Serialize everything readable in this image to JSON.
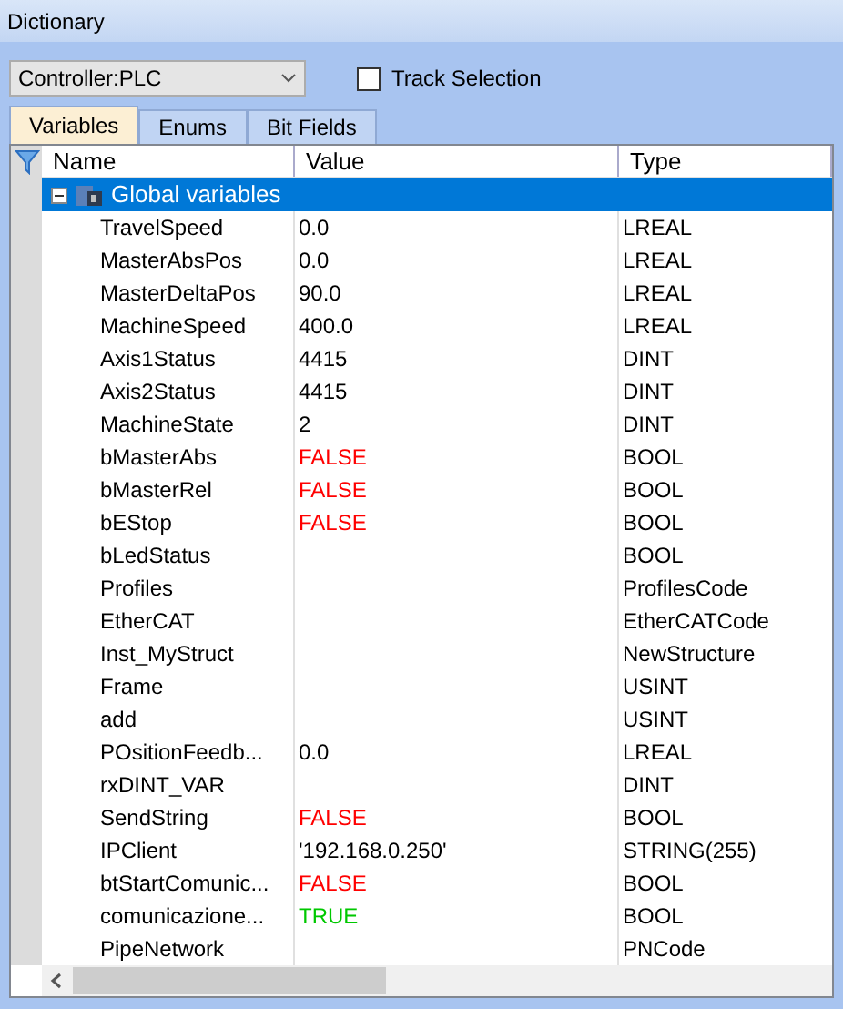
{
  "window": {
    "title": "Dictionary"
  },
  "controller_select": {
    "value": "Controller:PLC"
  },
  "track_selection": {
    "label": "Track Selection",
    "checked": false
  },
  "tabs": [
    {
      "label": "Variables",
      "selected": true
    },
    {
      "label": "Enums",
      "selected": false
    },
    {
      "label": "Bit Fields",
      "selected": false
    }
  ],
  "table": {
    "columns": [
      "Name",
      "Value",
      "Type"
    ],
    "group": {
      "label": "Global variables",
      "expanded": true,
      "selected": true
    },
    "rows": [
      {
        "name": "TravelSpeed",
        "value": "0.0",
        "type": "LREAL"
      },
      {
        "name": "MasterAbsPos",
        "value": "0.0",
        "type": "LREAL"
      },
      {
        "name": "MasterDeltaPos",
        "value": "90.0",
        "type": "LREAL"
      },
      {
        "name": "MachineSpeed",
        "value": "400.0",
        "type": "LREAL"
      },
      {
        "name": "Axis1Status",
        "value": "4415",
        "type": "DINT"
      },
      {
        "name": "Axis2Status",
        "value": "4415",
        "type": "DINT"
      },
      {
        "name": "MachineState",
        "value": "2",
        "type": "DINT"
      },
      {
        "name": "bMasterAbs",
        "value": "FALSE",
        "color": "#ff0000",
        "type": "BOOL"
      },
      {
        "name": "bMasterRel",
        "value": "FALSE",
        "color": "#ff0000",
        "type": "BOOL"
      },
      {
        "name": "bEStop",
        "value": "FALSE",
        "color": "#ff0000",
        "type": "BOOL"
      },
      {
        "name": "bLedStatus",
        "type": "BOOL"
      },
      {
        "name": "Profiles",
        "type": "ProfilesCode"
      },
      {
        "name": "EtherCAT",
        "type": "EtherCATCode"
      },
      {
        "name": "Inst_MyStruct",
        "type": "NewStructure"
      },
      {
        "name": "Frame",
        "type": "USINT"
      },
      {
        "name": "add",
        "type": "USINT"
      },
      {
        "name": "POsitionFeedb...",
        "value": "0.0",
        "type": "LREAL"
      },
      {
        "name": "rxDINT_VAR",
        "type": "DINT"
      },
      {
        "name": "SendString",
        "value": "FALSE",
        "color": "#ff0000",
        "type": "BOOL"
      },
      {
        "name": "IPClient",
        "value": "'192.168.0.250'",
        "type": "STRING(255)"
      },
      {
        "name": "btStartComunic...",
        "value": "FALSE",
        "color": "#ff0000",
        "type": "BOOL"
      },
      {
        "name": "comunicazione...",
        "value": "TRUE",
        "color": "#00c800",
        "type": "BOOL"
      },
      {
        "name": "PipeNetwork",
        "type": "PNCode"
      }
    ]
  }
}
